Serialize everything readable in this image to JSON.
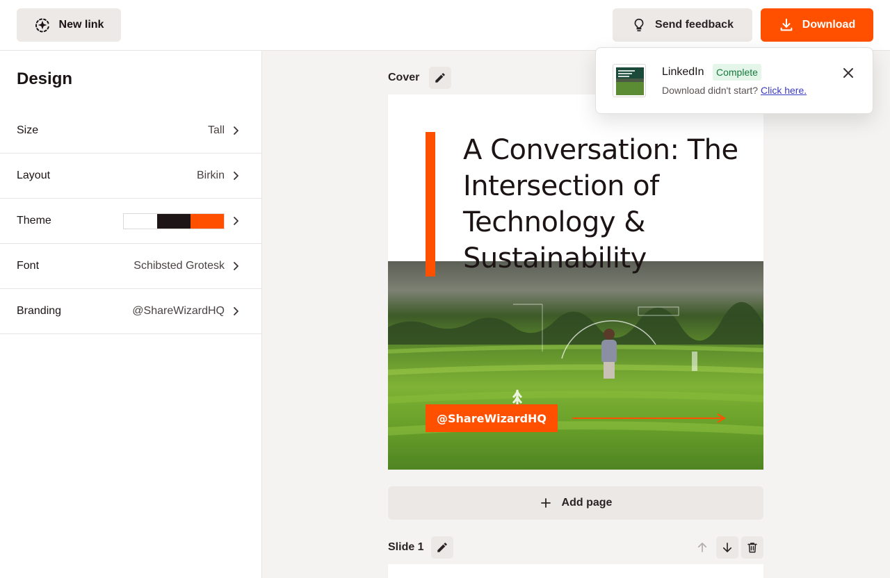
{
  "header": {
    "new_link_label": "New link",
    "feedback_label": "Send feedback",
    "download_label": "Download"
  },
  "sidebar": {
    "title": "Design",
    "settings": [
      {
        "label": "Size",
        "value": "Tall"
      },
      {
        "label": "Layout",
        "value": "Birkin"
      },
      {
        "label": "Theme",
        "value": ""
      },
      {
        "label": "Font",
        "value": "Schibsted Grotesk"
      },
      {
        "label": "Branding",
        "value": "@ShareWizardHQ"
      }
    ],
    "theme_colors": [
      "#ffffff",
      "#1e1516",
      "#ff5000"
    ]
  },
  "main": {
    "cover_label": "Cover",
    "cover": {
      "title": "A Conversation: The Intersection of Technology & Sustainability",
      "handle": "@ShareWizardHQ"
    },
    "add_page_label": "Add page",
    "slide_label": "Slide 1"
  },
  "toast": {
    "title": "LinkedIn",
    "badge": "Complete",
    "message": "Download didn't start?",
    "link": "Click here."
  },
  "colors": {
    "accent": "#ff5000",
    "dark": "#1c1414",
    "success_bg": "#e4f6ea",
    "success_text": "#157a3c"
  },
  "icons": {
    "new_link": "sparkle-circle-icon",
    "feedback": "lightbulb-icon",
    "download": "download-icon",
    "edit": "pencil-icon",
    "add": "plus-icon",
    "close": "close-icon",
    "chevron": "chevron-right-icon",
    "move_up": "arrow-up-icon",
    "move_down": "arrow-down-icon",
    "delete": "trash-icon"
  }
}
